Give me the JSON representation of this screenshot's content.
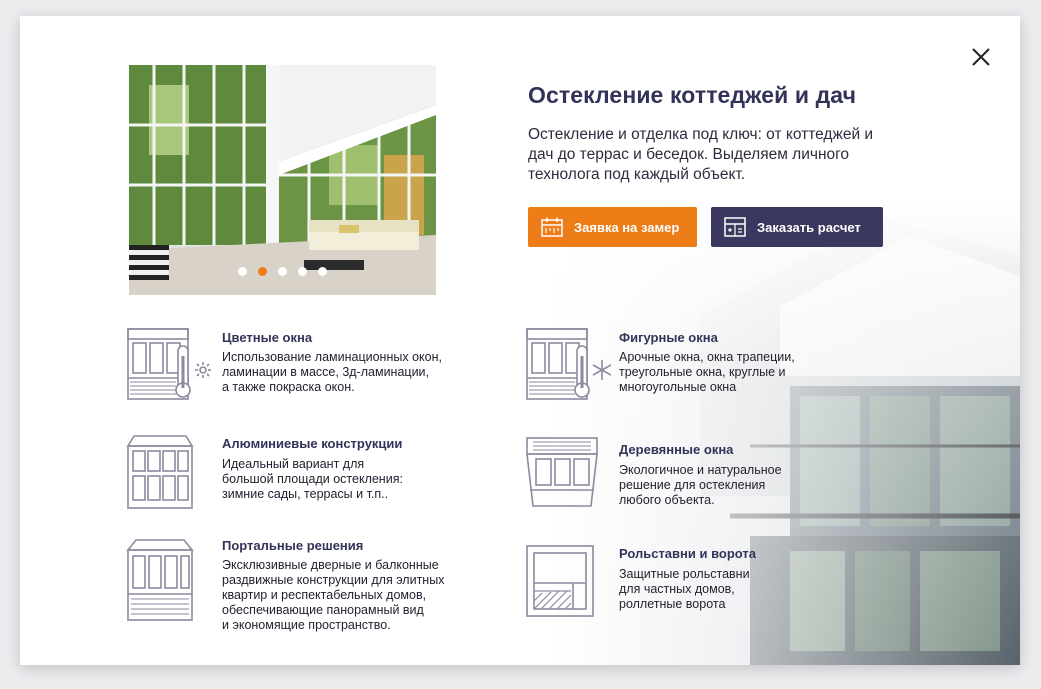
{
  "header": {
    "title": "Остекление коттеджей и дач",
    "description": "Остекление и отделка под ключ: от коттеджей и дач до террас и беседок. Выделяем личного технолога под каждый объект."
  },
  "buttons": {
    "measure": "Заявка на замер",
    "calculate": "Заказать расчет"
  },
  "slider": {
    "count": 5,
    "active": 2
  },
  "colors": {
    "accent": "#ee7c17",
    "brand_dark": "#3b385f",
    "title": "#33335a",
    "icon": "#8a8aa0"
  },
  "features": [
    {
      "title": "Цветные окна",
      "lines": [
        "Использование ламинационных окон,",
        "ламинации в массе, 3д-ламинации,",
        "а также покраска окон."
      ],
      "icon": "window-thermometer-sun-icon"
    },
    {
      "title": "Фигурные окна",
      "lines": [
        "Арочные окна, окна трапеции,",
        "треугольные окна, круглые и",
        "многоугольные окна"
      ],
      "icon": "window-thermometer-snow-icon"
    },
    {
      "title": "Алюминиевые конструкции",
      "lines": [
        "Идеальный вариант для",
        "большой площади остекления:",
        "зимние сады, террасы и т.п.."
      ],
      "icon": "aluminum-frame-icon"
    },
    {
      "title": "Деревянные окна",
      "lines": [
        "Экологичное и натуральное",
        "решение для остекления",
        "любого объекта."
      ],
      "icon": "wooden-window-icon"
    },
    {
      "title": "Портальные решения",
      "lines": [
        "Эксклюзивные дверные и балконные",
        "раздвижные конструкции для элитных",
        "квартир и респектабельных домов,",
        "обеспечивающие панорамный вид",
        "и экономящие пространство."
      ],
      "icon": "portal-door-icon"
    },
    {
      "title": "Рольставни и ворота",
      "lines": [
        "Защитные рольставни",
        "для частных домов,",
        "роллетные ворота"
      ],
      "icon": "roller-shutter-icon"
    }
  ]
}
